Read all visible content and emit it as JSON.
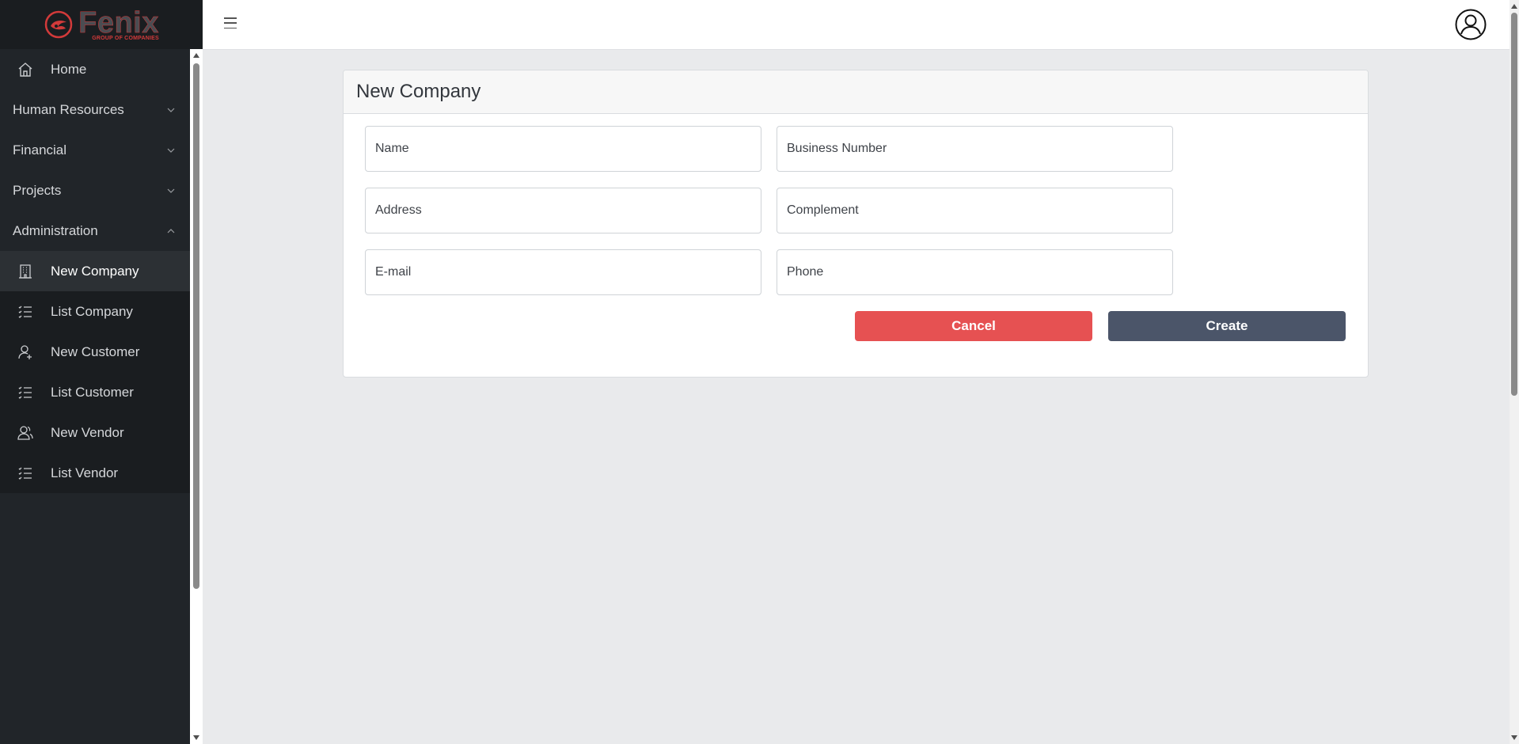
{
  "brand": {
    "name": "Fenix",
    "tagline": "GROUP OF COMPANIES"
  },
  "colors": {
    "sidebar_bg": "#212529",
    "accent_red": "#e65152",
    "primary_dark": "#4b5569",
    "brand_red": "#d23a3a"
  },
  "sidebar": {
    "home": {
      "label": "Home",
      "icon": "home-icon"
    },
    "sections": [
      {
        "label": "Human Resources",
        "expanded": false
      },
      {
        "label": "Financial",
        "expanded": false
      },
      {
        "label": "Projects",
        "expanded": false
      },
      {
        "label": "Administration",
        "expanded": true
      }
    ],
    "admin_items": [
      {
        "label": "New Company",
        "icon": "building-icon",
        "active": true
      },
      {
        "label": "List Company",
        "icon": "list-icon"
      },
      {
        "label": "New Customer",
        "icon": "user-add-icon"
      },
      {
        "label": "List Customer",
        "icon": "list-icon"
      },
      {
        "label": "New Vendor",
        "icon": "users-icon"
      },
      {
        "label": "List Vendor",
        "icon": "list-icon"
      }
    ]
  },
  "topbar": {
    "menu_icon": "hamburger-icon",
    "profile_icon": "user-circle-icon"
  },
  "form": {
    "title": "New Company",
    "fields": {
      "name": {
        "placeholder": "Name",
        "value": ""
      },
      "business_number": {
        "placeholder": "Business Number",
        "value": ""
      },
      "address": {
        "placeholder": "Address",
        "value": ""
      },
      "complement": {
        "placeholder": "Complement",
        "value": ""
      },
      "email": {
        "placeholder": "E-mail",
        "value": ""
      },
      "phone": {
        "placeholder": "Phone",
        "value": ""
      }
    },
    "cancel_label": "Cancel",
    "create_label": "Create"
  }
}
